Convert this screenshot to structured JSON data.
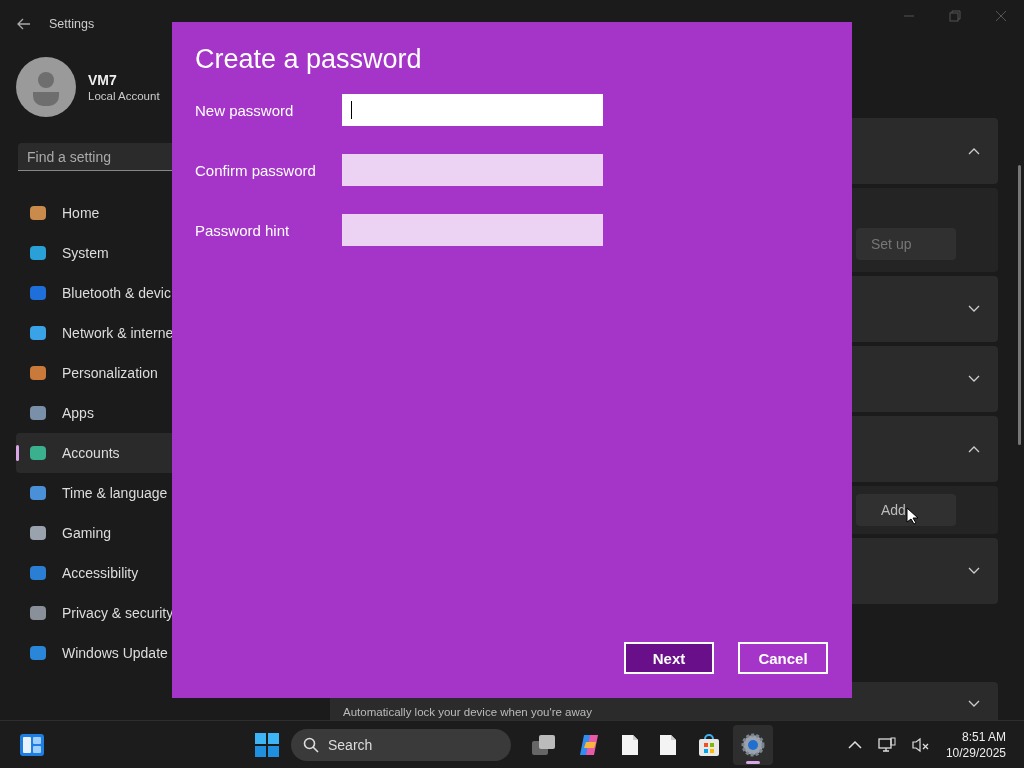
{
  "settings_window": {
    "title": "Settings",
    "user": {
      "name": "VM7",
      "account_type": "Local Account"
    },
    "search": {
      "placeholder": "Find a setting"
    },
    "nav_items": [
      {
        "label": "Home",
        "selected": false
      },
      {
        "label": "System",
        "selected": false
      },
      {
        "label": "Bluetooth & devic",
        "selected": false
      },
      {
        "label": "Network & interne",
        "selected": false
      },
      {
        "label": "Personalization",
        "selected": false
      },
      {
        "label": "Apps",
        "selected": false
      },
      {
        "label": "Accounts",
        "selected": true
      },
      {
        "label": "Time & language",
        "selected": false
      },
      {
        "label": "Gaming",
        "selected": false
      },
      {
        "label": "Accessibility",
        "selected": false
      },
      {
        "label": "Privacy & security",
        "selected": false
      },
      {
        "label": "Windows Update",
        "selected": false
      }
    ],
    "cards": [
      {
        "expanded": true,
        "button": "Set up"
      },
      {
        "expanded": false
      },
      {
        "expanded": false
      },
      {
        "expanded": true,
        "button": "Add"
      },
      {
        "expanded": false
      },
      {
        "expanded": false,
        "description": "Automatically lock your device when you're away"
      }
    ]
  },
  "dialog": {
    "title": "Create a password",
    "fields": [
      {
        "label": "New password",
        "focused": true
      },
      {
        "label": "Confirm password",
        "focused": false
      },
      {
        "label": "Password hint",
        "focused": false
      }
    ],
    "buttons": [
      {
        "label": "Next",
        "kind": "primary"
      },
      {
        "label": "Cancel",
        "kind": "secondary"
      }
    ]
  },
  "taskbar": {
    "search_placeholder": "Search",
    "time": "8:51 AM",
    "date": "10/29/2025"
  }
}
